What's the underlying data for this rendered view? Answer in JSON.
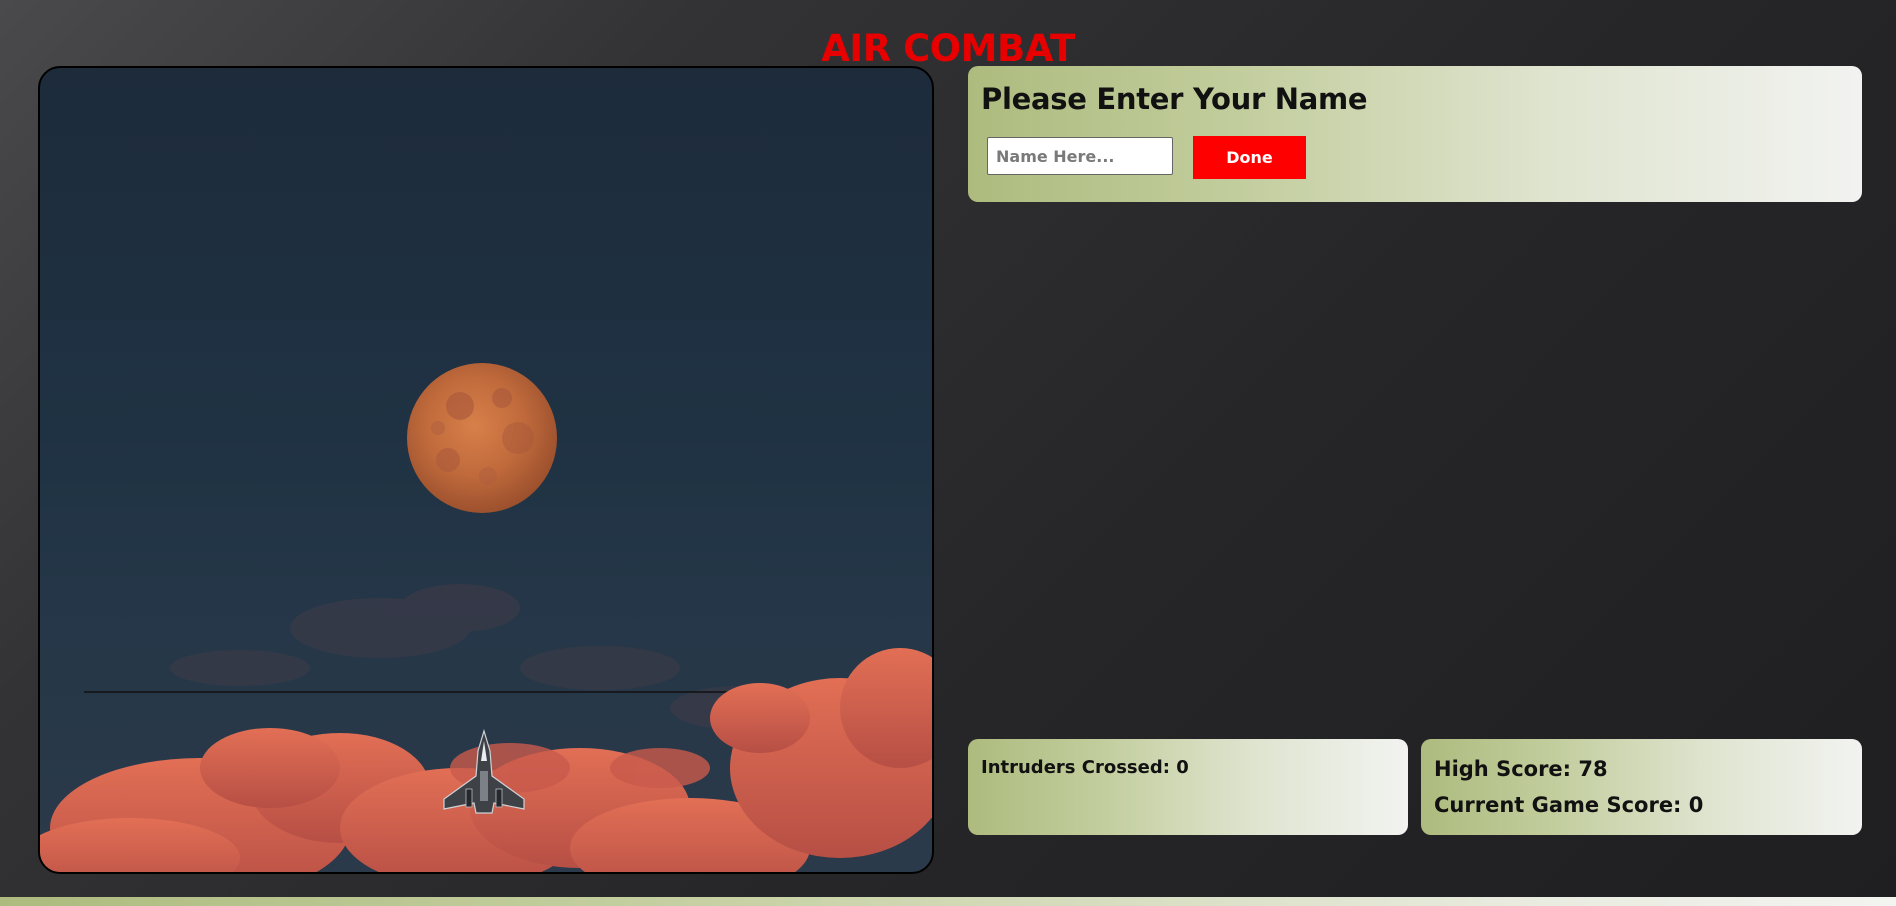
{
  "app": {
    "title": "AIR COMBAT"
  },
  "name_form": {
    "heading": "Please Enter Your Name",
    "input_value": "",
    "input_placeholder": "Name Here...",
    "done_label": "Done"
  },
  "stats": {
    "intruders_label": "Intruders Crossed: 0",
    "high_score_label": "High Score: 78",
    "current_score_label": "Current Game Score: 0"
  },
  "scene": {
    "background": "night sky with full moon and red-orange clouds",
    "player_sprite": "fighter-jet-icon",
    "boundary_line": "intruder boundary line"
  },
  "colors": {
    "title": "#e60000",
    "done_button": "#ff0000",
    "panel_gradient_start": "#adbb7e",
    "panel_gradient_end": "#f2f3f1"
  }
}
